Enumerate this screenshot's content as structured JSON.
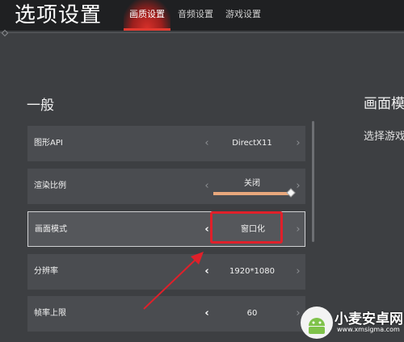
{
  "header": {
    "title": "选项设置",
    "tabs": [
      {
        "label": "画质设置",
        "active": true
      },
      {
        "label": "音频设置",
        "active": false
      },
      {
        "label": "游戏设置",
        "active": false
      }
    ]
  },
  "section": {
    "title": "一般"
  },
  "settings": [
    {
      "label": "图形API",
      "value": "DirectX11"
    },
    {
      "label": "渲染比例",
      "value": "关闭",
      "slider_level": 1.0
    },
    {
      "label": "画面模式",
      "value": "窗口化"
    },
    {
      "label": "分辨率",
      "value": "1920*1080"
    },
    {
      "label": "帧率上限",
      "value": "60"
    }
  ],
  "side_panel": {
    "title": "画面模",
    "description": "选择游戏"
  },
  "watermark": {
    "name": "小麦安卓网",
    "url": "www.xmsigma.com"
  },
  "colors": {
    "accent": "#e0202a",
    "slider": "#e8a87c",
    "row_bg": "#4a4c50"
  }
}
